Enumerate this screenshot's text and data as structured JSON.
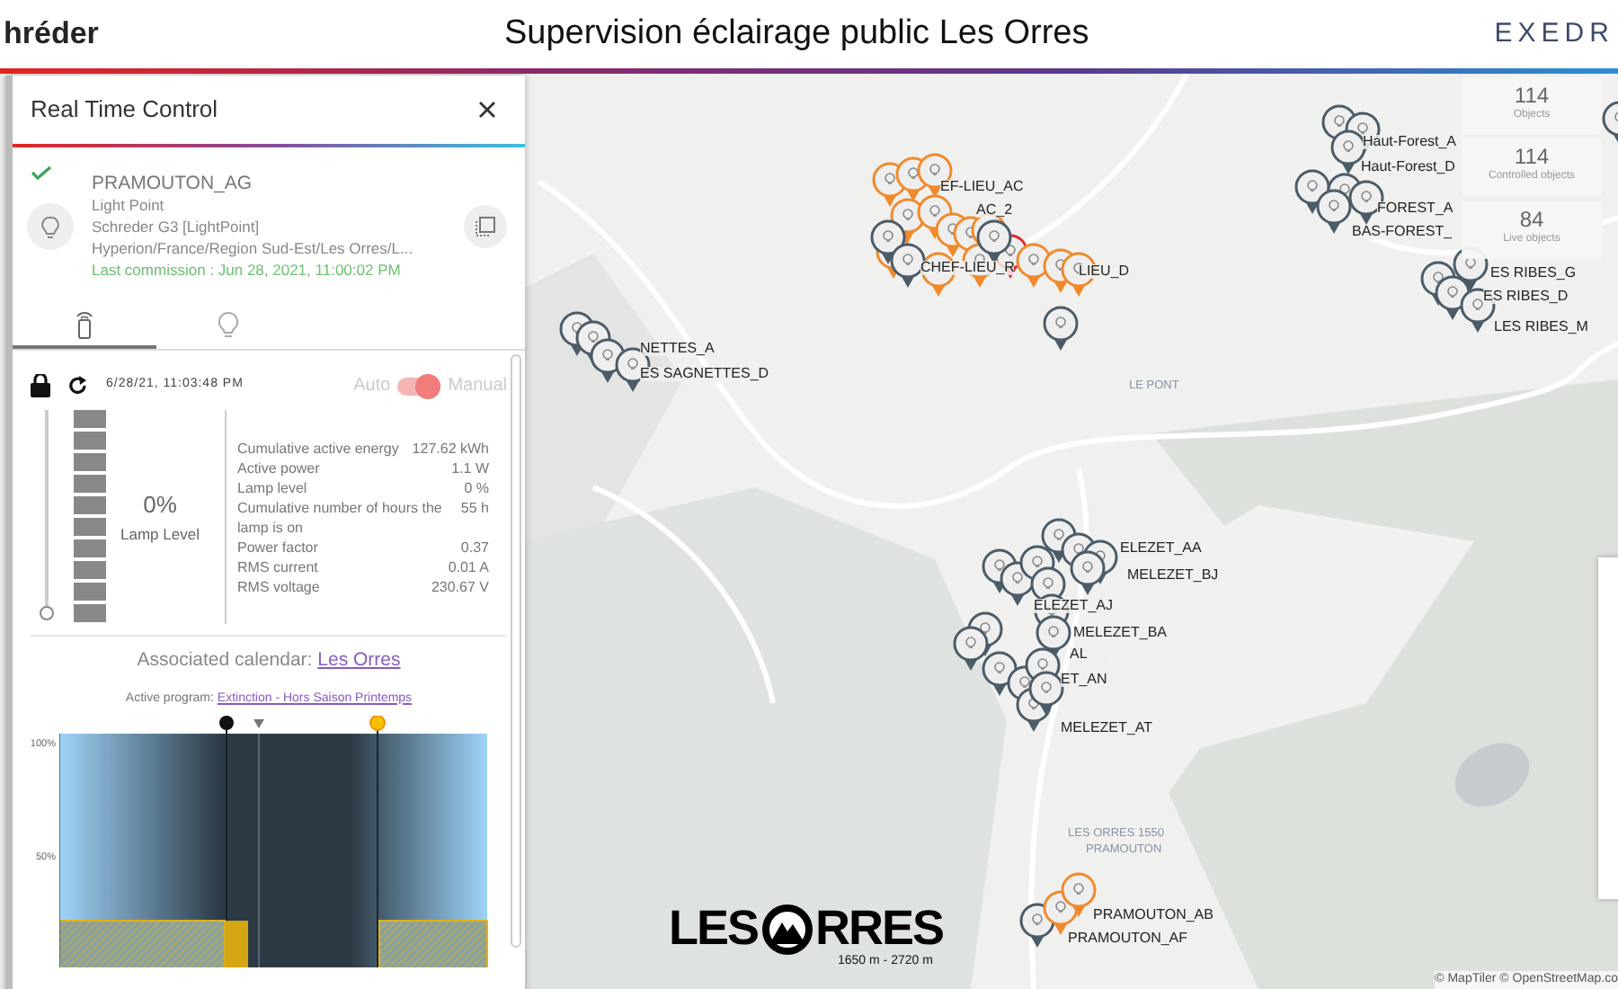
{
  "header": {
    "logo_left": "hréder",
    "title": "Supervision éclairage public Les Orres",
    "logo_right": "EXEDR"
  },
  "panel": {
    "title": "Real Time Control",
    "device": {
      "name": "PRAMOUTON_AG",
      "type": "Light Point",
      "model": "Schreder G3 [LightPoint]",
      "path": "Hyperion/France/Region Sud-Est/Les Orres/L...",
      "commission": "Last commission : Jun 28, 2021, 11:00:02 PM",
      "commissioned": true
    },
    "tabs": [
      {
        "kind": "remote",
        "selected": true
      },
      {
        "kind": "bulb",
        "selected": false
      }
    ],
    "control": {
      "locked": true,
      "timestamp": "6/28/21, 11:03:48 PM",
      "mode_auto": "Auto",
      "mode_manual": "Manual",
      "manual": true,
      "level": 0,
      "lamp_value": "0%",
      "lamp_label": "Lamp Level"
    },
    "metrics": [
      {
        "label": "Cumulative active energy",
        "value": "127.62 kWh"
      },
      {
        "label": "Active power",
        "value": "1.1 W"
      },
      {
        "label": "Lamp level",
        "value": "0 %"
      },
      {
        "label": "Cumulative number of hours the lamp is on",
        "value": "55 h"
      },
      {
        "label": "Power factor",
        "value": "0.37"
      },
      {
        "label": "RMS current",
        "value": "0.01 A"
      },
      {
        "label": "RMS voltage",
        "value": "230.67 V"
      }
    ],
    "calendar": {
      "label": "Associated calendar:",
      "link": "Les Orres"
    },
    "program": {
      "label": "Active program:",
      "link": "Extinction - Hors Saison Printemps"
    },
    "schedule": {
      "y_ticks": [
        "100%",
        "50%"
      ]
    }
  },
  "map": {
    "labels": [
      "EF-LIEU_AC",
      "AC_2",
      "CHEF-LIEU_R",
      "LIEU_D",
      "NETTES_A",
      "ES SAGNETTES_D",
      "Haut-Forest_A",
      "Haut-Forest_D",
      "FOREST_A",
      "BAS-FOREST_",
      "ES RIBES_G",
      "ES RIBES_D",
      "LES RIBES_M",
      "LE PONT",
      "ELEZET_AA",
      "MELEZET_BJ",
      "ELEZET_AJ",
      "MELEZET_BA",
      "AL",
      "ET_AN",
      "MELEZET_AT",
      "LES ORRES 1550",
      "PRAMOUTON",
      "PRAMOUTON_AB",
      "PRAMOUTON_AF"
    ],
    "attribution": "© MapTiler © OpenStreetMap.co",
    "logo": {
      "left": "LES",
      "right": "RRES",
      "altitude": "1650 m - 2720 m"
    }
  },
  "stats": [
    {
      "value": "114",
      "label": "Objects"
    },
    {
      "value": "114",
      "label": "Controlled objects"
    },
    {
      "value": "84",
      "label": "Live objects"
    }
  ]
}
